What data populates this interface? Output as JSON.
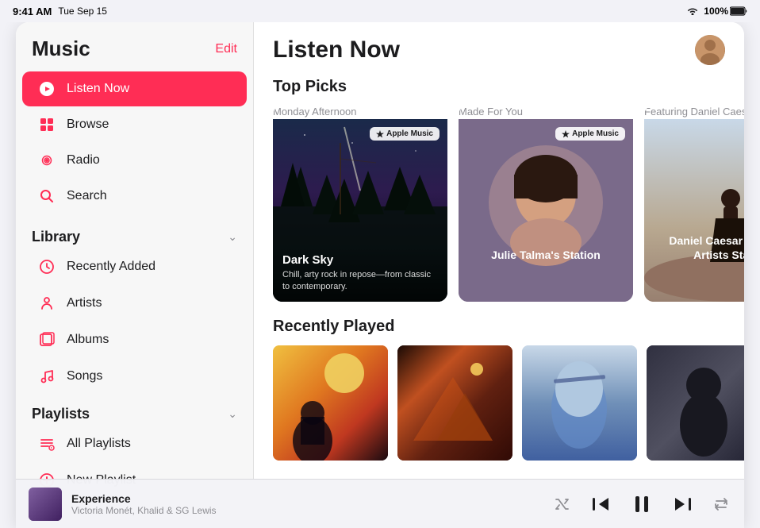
{
  "statusBar": {
    "time": "9:41 AM",
    "date": "Tue Sep 15",
    "wifi": "wifi",
    "battery": "100%"
  },
  "sidebar": {
    "title": "Music",
    "editLabel": "Edit",
    "nav": [
      {
        "id": "listen-now",
        "label": "Listen Now",
        "icon": "▶",
        "active": true
      },
      {
        "id": "browse",
        "label": "Browse",
        "icon": "⊞",
        "active": false
      },
      {
        "id": "radio",
        "label": "Radio",
        "icon": "📻",
        "active": false
      },
      {
        "id": "search",
        "label": "Search",
        "icon": "🔍",
        "active": false
      }
    ],
    "librarySection": "Library",
    "libraryItems": [
      {
        "id": "recently-added",
        "label": "Recently Added",
        "icon": "🕐"
      },
      {
        "id": "artists",
        "label": "Artists",
        "icon": "🎤"
      },
      {
        "id": "albums",
        "label": "Albums",
        "icon": "📀"
      },
      {
        "id": "songs",
        "label": "Songs",
        "icon": "🎵"
      }
    ],
    "playlistsSection": "Playlists",
    "playlistItems": [
      {
        "id": "all-playlists",
        "label": "All Playlists",
        "icon": "≡"
      },
      {
        "id": "new-playlist",
        "label": "New Playlist",
        "icon": "+"
      }
    ]
  },
  "main": {
    "pageTitle": "Listen Now",
    "topPicksTitle": "Top Picks",
    "cards": [
      {
        "id": "dark-sky",
        "sublabel": "Monday Afternoon",
        "name": "Dark Sky",
        "desc": "Chill, arty rock in repose—from classic to contemporary.",
        "badge": "Apple Music"
      },
      {
        "id": "julie-talma",
        "sublabel": "Made For You",
        "name": "Julie Talma's Station",
        "desc": "",
        "badge": "Apple Music"
      },
      {
        "id": "daniel-caesar",
        "sublabel": "Featuring Daniel Caesar",
        "name": "Daniel Caesar & Similar Artists Station",
        "desc": "",
        "badge": ""
      }
    ],
    "recentlyPlayedTitle": "Recently Played",
    "recentAlbums": [
      {
        "id": "album1",
        "style": "album-1"
      },
      {
        "id": "album2",
        "style": "album-2"
      },
      {
        "id": "album3",
        "style": "album-3"
      },
      {
        "id": "album4",
        "style": "album-4"
      },
      {
        "id": "album5",
        "style": "album-5"
      }
    ]
  },
  "nowPlaying": {
    "title": "Experience",
    "artist": "Victoria Monét, Khalid & SG Lewis",
    "shuffleIcon": "shuffle",
    "prevIcon": "prev",
    "playPauseIcon": "pause",
    "nextIcon": "next",
    "repeatIcon": "repeat"
  }
}
